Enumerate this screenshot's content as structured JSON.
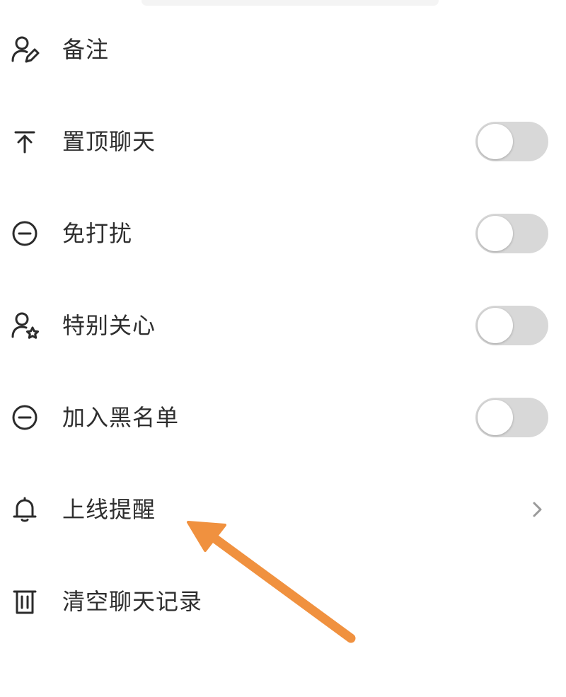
{
  "menu": {
    "items": [
      {
        "label": "备注",
        "icon": "user-edit-icon"
      },
      {
        "label": "置顶聊天",
        "icon": "pin-top-icon",
        "toggle_on": false
      },
      {
        "label": "免打扰",
        "icon": "minus-circle-icon",
        "toggle_on": false
      },
      {
        "label": "特别关心",
        "icon": "user-star-icon",
        "toggle_on": false
      },
      {
        "label": "加入黑名单",
        "icon": "minus-circle-icon",
        "toggle_on": false
      },
      {
        "label": "上线提醒",
        "icon": "bell-icon",
        "trailing": "chevron-right-icon"
      },
      {
        "label": "清空聊天记录",
        "icon": "trash-icon"
      }
    ]
  },
  "colors": {
    "text": "#2e2e2e",
    "icon": "#2b2b2b",
    "toggle_off_track": "#d8d8d8",
    "toggle_knob": "#ffffff",
    "chevron": "#9a9a9a",
    "annotation_arrow": "#f0913f"
  },
  "annotation": {
    "type": "arrow",
    "points_to": "上线提醒"
  }
}
